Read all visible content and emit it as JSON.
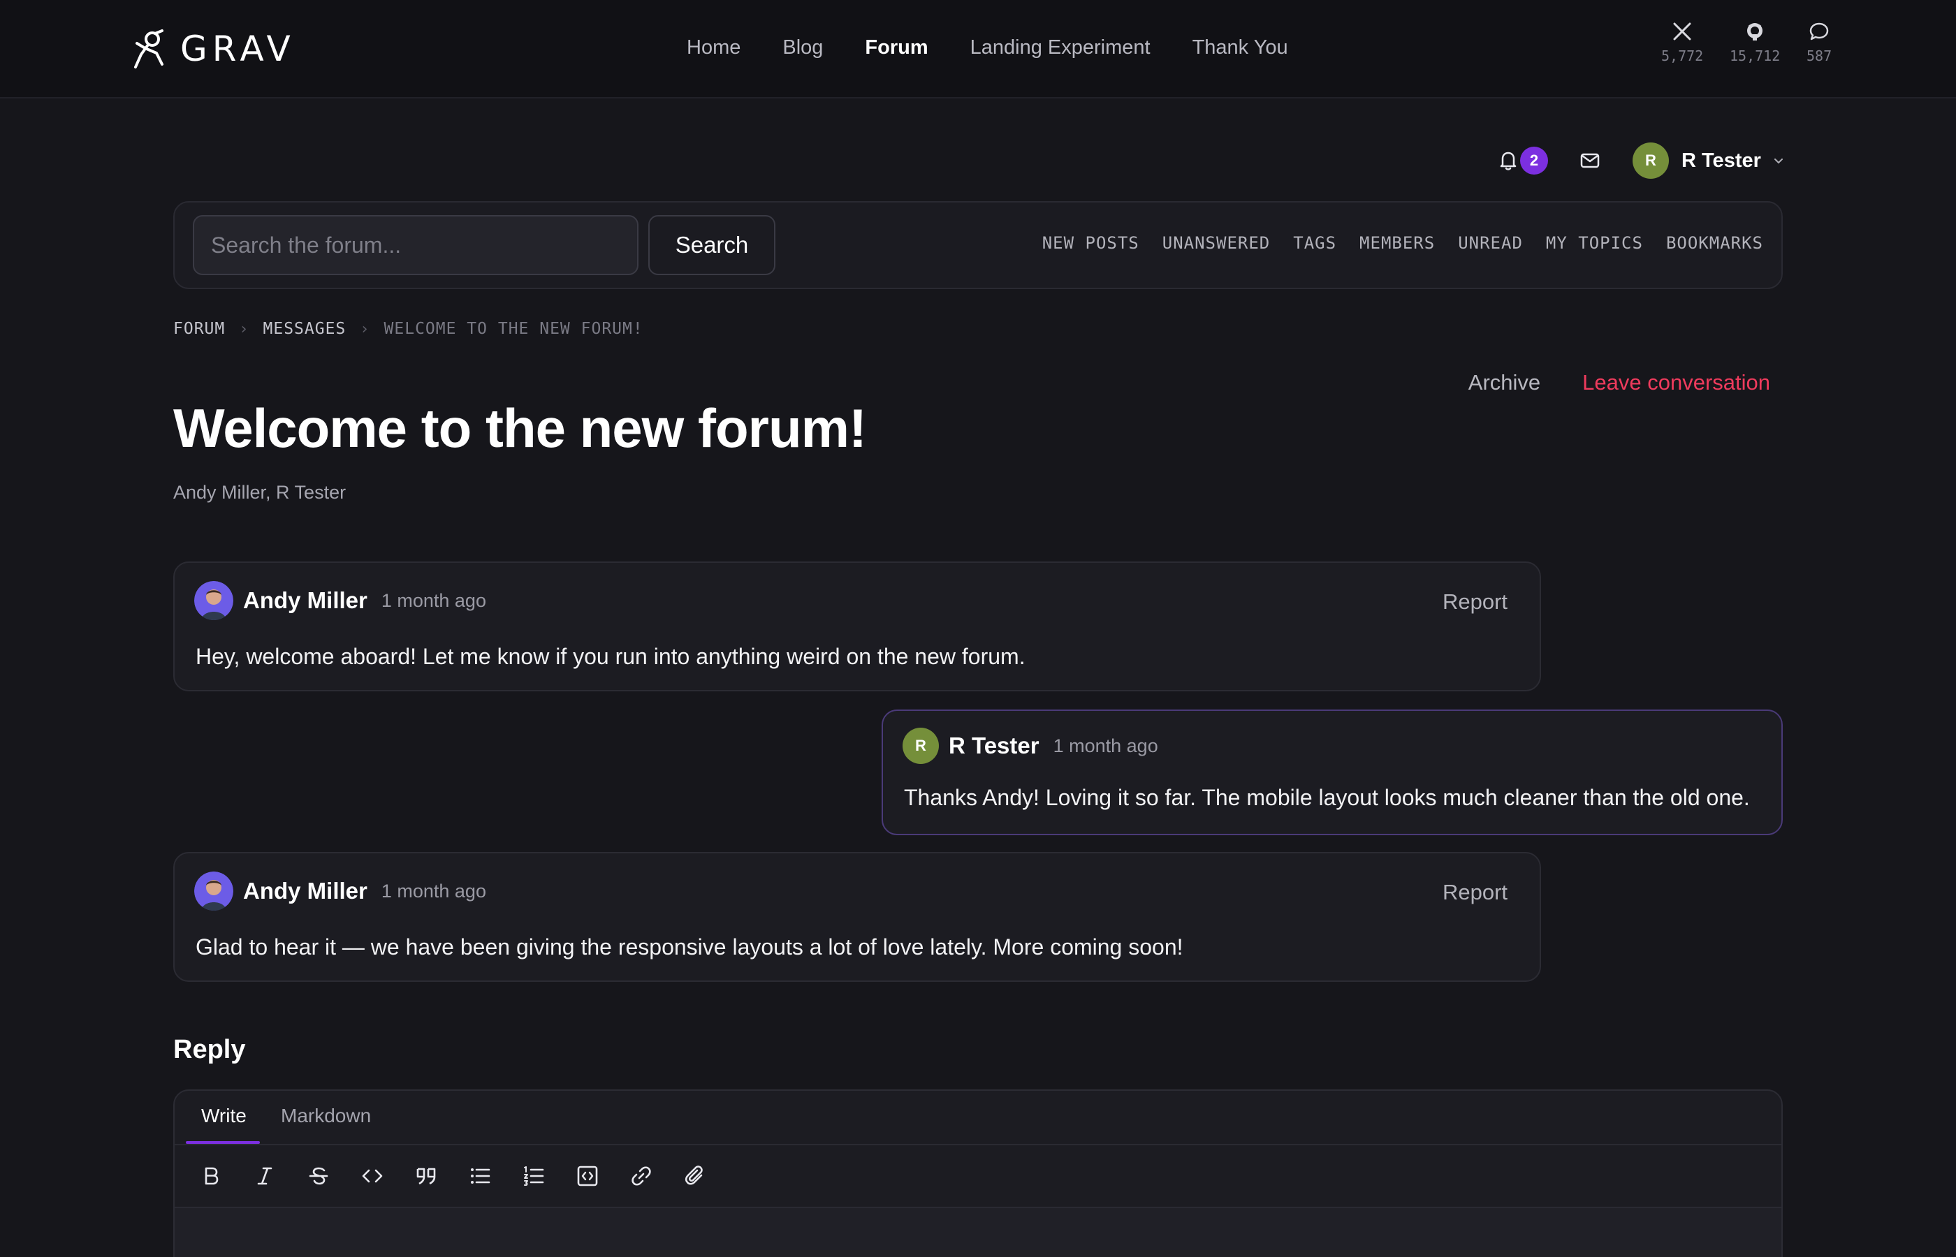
{
  "brand": {
    "name": "GRAV"
  },
  "nav": {
    "items": [
      {
        "label": "Home",
        "active": false
      },
      {
        "label": "Blog",
        "active": false
      },
      {
        "label": "Forum",
        "active": true
      },
      {
        "label": "Landing Experiment",
        "active": false
      },
      {
        "label": "Thank You",
        "active": false
      }
    ]
  },
  "social": {
    "x": {
      "icon": "x-icon",
      "count": "5,772"
    },
    "github": {
      "icon": "github-icon",
      "count": "15,712"
    },
    "chat": {
      "icon": "chat-icon",
      "count": "587"
    }
  },
  "user": {
    "notifications_count": "2",
    "avatar_initial": "R",
    "name": "R Tester"
  },
  "search": {
    "placeholder": "Search the forum...",
    "value": "",
    "button_label": "Search"
  },
  "subnav": {
    "items": [
      "NEW POSTS",
      "UNANSWERED",
      "TAGS",
      "MEMBERS",
      "UNREAD",
      "MY TOPICS",
      "BOOKMARKS"
    ]
  },
  "breadcrumb": {
    "items": [
      "FORUM",
      "MESSAGES",
      "WELCOME TO THE NEW FORUM!"
    ]
  },
  "conversation": {
    "title": "Welcome to the new forum!",
    "participants": "Andy Miller, R Tester",
    "archive_label": "Archive",
    "leave_label": "Leave conversation"
  },
  "messages": [
    {
      "author": "Andy Miller",
      "time": "1 month ago",
      "report_label": "Report",
      "body": "Hey, welcome aboard! Let me know if you run into anything weird on the new forum."
    },
    {
      "author": "R Tester",
      "avatar_initial": "R",
      "time": "1 month ago",
      "body": "Thanks Andy! Loving it so far. The mobile layout looks much cleaner than the old one."
    },
    {
      "author": "Andy Miller",
      "time": "1 month ago",
      "report_label": "Report",
      "body": "Glad to hear it — we have been giving the responsive layouts a lot of love lately. More coming soon!"
    }
  ],
  "reply": {
    "heading": "Reply",
    "tabs": [
      "Write",
      "Markdown"
    ],
    "toolbar": [
      "bold-icon",
      "italic-icon",
      "strikethrough-icon",
      "inline-code-icon",
      "quote-icon",
      "bullet-list-icon",
      "numbered-list-icon",
      "code-block-icon",
      "link-icon",
      "attach-icon"
    ]
  },
  "colors": {
    "accent": "#7c2fe0",
    "danger": "#ef3b5d",
    "background": "#16161b",
    "avatar_green": "#758f3a"
  }
}
